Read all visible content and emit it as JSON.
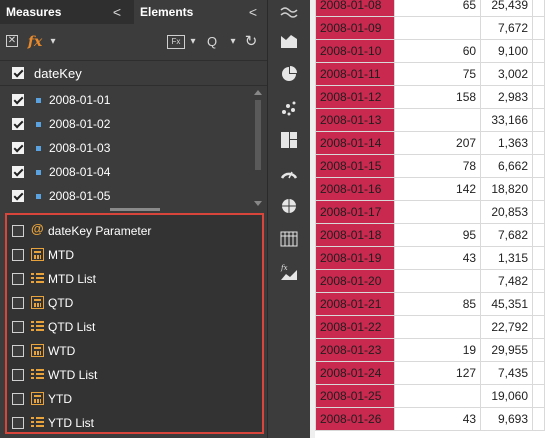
{
  "tabs": {
    "measures": "Measures",
    "elements": "Elements",
    "chevron": "<"
  },
  "toolbar": {
    "fx": "fx",
    "fx_box": "Fx",
    "caret": "▾",
    "search": "Q",
    "refresh": "↻",
    "close": "✕"
  },
  "datekey": {
    "label": "dateKey"
  },
  "dates": [
    {
      "label": "2008-01-01",
      "checked": true
    },
    {
      "label": "2008-01-02",
      "checked": true
    },
    {
      "label": "2008-01-03",
      "checked": true
    },
    {
      "label": "2008-01-04",
      "checked": true
    },
    {
      "label": "2008-01-05",
      "checked": true
    }
  ],
  "measures": [
    {
      "label": "dateKey Parameter",
      "icon": "at-icon"
    },
    {
      "label": "MTD",
      "icon": "calculator-icon"
    },
    {
      "label": "MTD List",
      "icon": "list-icon"
    },
    {
      "label": "QTD",
      "icon": "calculator-icon"
    },
    {
      "label": "QTD List",
      "icon": "list-icon"
    },
    {
      "label": "WTD",
      "icon": "calculator-icon"
    },
    {
      "label": "WTD List",
      "icon": "list-icon"
    },
    {
      "label": "YTD",
      "icon": "calculator-icon"
    },
    {
      "label": "YTD List",
      "icon": "list-icon"
    }
  ],
  "sidebar_icons": [
    "area-chart-icon",
    "map-icon",
    "pie-chart-icon",
    "scatter-icon",
    "treemap-icon",
    "gauge-icon",
    "globe-icon",
    "table-icon",
    "fx-chart-icon"
  ],
  "colors": {
    "accent": "#e8892b",
    "highlight": "#d8453b",
    "date_cell": "#c9294f",
    "panel": "#3c3c3c"
  },
  "rows": [
    {
      "date": "2008-01-08",
      "a": "65",
      "b": "25,439"
    },
    {
      "date": "2008-01-09",
      "a": "",
      "b": "7,672"
    },
    {
      "date": "2008-01-10",
      "a": "60",
      "b": "9,100"
    },
    {
      "date": "2008-01-11",
      "a": "75",
      "b": "3,002"
    },
    {
      "date": "2008-01-12",
      "a": "158",
      "b": "2,983"
    },
    {
      "date": "2008-01-13",
      "a": "",
      "b": "33,166"
    },
    {
      "date": "2008-01-14",
      "a": "207",
      "b": "1,363"
    },
    {
      "date": "2008-01-15",
      "a": "78",
      "b": "6,662"
    },
    {
      "date": "2008-01-16",
      "a": "142",
      "b": "18,820"
    },
    {
      "date": "2008-01-17",
      "a": "",
      "b": "20,853"
    },
    {
      "date": "2008-01-18",
      "a": "95",
      "b": "7,682"
    },
    {
      "date": "2008-01-19",
      "a": "43",
      "b": "1,315"
    },
    {
      "date": "2008-01-20",
      "a": "",
      "b": "7,482"
    },
    {
      "date": "2008-01-21",
      "a": "85",
      "b": "45,351"
    },
    {
      "date": "2008-01-22",
      "a": "",
      "b": "22,792"
    },
    {
      "date": "2008-01-23",
      "a": "19",
      "b": "29,955"
    },
    {
      "date": "2008-01-24",
      "a": "127",
      "b": "7,435"
    },
    {
      "date": "2008-01-25",
      "a": "",
      "b": "19,060"
    },
    {
      "date": "2008-01-26",
      "a": "43",
      "b": "9,693"
    }
  ]
}
